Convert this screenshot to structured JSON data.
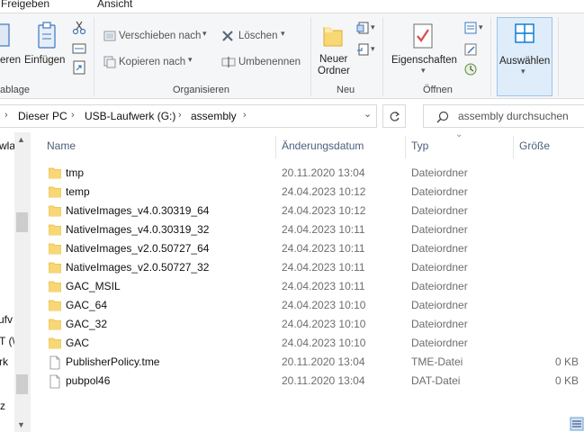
{
  "tabs": [
    "Freigeben",
    "Ansicht"
  ],
  "ribbon": {
    "clipboard": {
      "cut_label": "eren",
      "paste_label": "Einfügen",
      "group_label": "ablage"
    },
    "organize": {
      "move_label": "Verschieben nach",
      "copy_label": "Kopieren nach",
      "delete_label": "Löschen",
      "rename_label": "Umbenennen",
      "group_label": "Organisieren"
    },
    "new": {
      "folder_label_1": "Neuer",
      "folder_label_2": "Ordner",
      "group_label": "Neu"
    },
    "open": {
      "properties_label": "Eigenschaften",
      "group_label": "Öffnen"
    },
    "select": {
      "label": "Auswählen"
    }
  },
  "address": {
    "crumbs": [
      "Dieser PC",
      "USB-Laufwerk (G:)",
      "assembly"
    ],
    "search_placeholder": "assembly durchsuchen"
  },
  "nav": {
    "items": [
      "wla",
      "ufv",
      "T (\\",
      "rk",
      "z"
    ]
  },
  "columns": {
    "name": "Name",
    "date": "Änderungsdatum",
    "type": "Typ",
    "size": "Größe"
  },
  "files": [
    {
      "name": "tmp",
      "date": "20.11.2020 13:04",
      "type": "Dateiordner",
      "size": "",
      "kind": "folder"
    },
    {
      "name": "temp",
      "date": "24.04.2023 10:12",
      "type": "Dateiordner",
      "size": "",
      "kind": "folder"
    },
    {
      "name": "NativeImages_v4.0.30319_64",
      "date": "24.04.2023 10:12",
      "type": "Dateiordner",
      "size": "",
      "kind": "folder"
    },
    {
      "name": "NativeImages_v4.0.30319_32",
      "date": "24.04.2023 10:11",
      "type": "Dateiordner",
      "size": "",
      "kind": "folder"
    },
    {
      "name": "NativeImages_v2.0.50727_64",
      "date": "24.04.2023 10:11",
      "type": "Dateiordner",
      "size": "",
      "kind": "folder"
    },
    {
      "name": "NativeImages_v2.0.50727_32",
      "date": "24.04.2023 10:11",
      "type": "Dateiordner",
      "size": "",
      "kind": "folder"
    },
    {
      "name": "GAC_MSIL",
      "date": "24.04.2023 10:11",
      "type": "Dateiordner",
      "size": "",
      "kind": "folder"
    },
    {
      "name": "GAC_64",
      "date": "24.04.2023 10:10",
      "type": "Dateiordner",
      "size": "",
      "kind": "folder"
    },
    {
      "name": "GAC_32",
      "date": "24.04.2023 10:10",
      "type": "Dateiordner",
      "size": "",
      "kind": "folder"
    },
    {
      "name": "GAC",
      "date": "24.04.2023 10:10",
      "type": "Dateiordner",
      "size": "",
      "kind": "folder"
    },
    {
      "name": "PublisherPolicy.tme",
      "date": "20.11.2020 13:04",
      "type": "TME-Datei",
      "size": "0 KB",
      "kind": "file"
    },
    {
      "name": "pubpol46",
      "date": "20.11.2020 13:04",
      "type": "DAT-Datei",
      "size": "0 KB",
      "kind": "file"
    }
  ],
  "colors": {
    "folder": "#f8d775",
    "folder_dark": "#e8b93c",
    "accent": "#0078d7",
    "header_text": "#4c607a"
  }
}
